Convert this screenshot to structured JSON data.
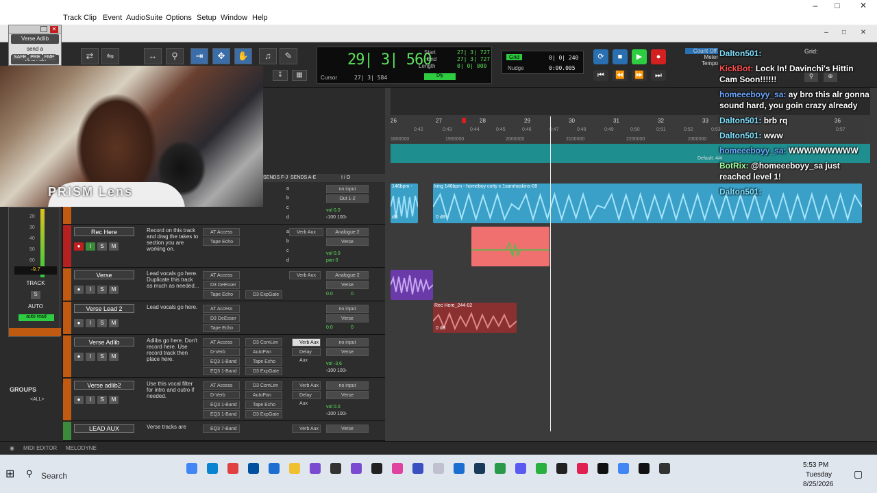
{
  "menu": {
    "items": [
      "Track",
      "Clip",
      "Event",
      "AudioSuite",
      "Options",
      "Setup",
      "Window",
      "Help"
    ]
  },
  "floatwin": {
    "title": "Verse Adlib",
    "send": "send a",
    "bus": "Verb Aux",
    "buttons": [
      "SAFE",
      "PRE",
      "FMP"
    ]
  },
  "counter": {
    "main": "29| 3| 560",
    "start_label": "Start",
    "end_label": "End",
    "length_label": "Length",
    "start": "27| 3| 727",
    "end": "27| 3| 727",
    "length": "0| 0| 000",
    "cursor_label": "Cursor",
    "cursor": "27| 3| 584"
  },
  "grid": {
    "grid_label": "Grid",
    "grid_value": "0| 0| 240",
    "nudge_label": "Nudge",
    "nudge_value": "0:00.005",
    "grid_label_right": "Grid:"
  },
  "transport": {
    "count_off": "Count Off",
    "meter": "Meter",
    "tempo": "Tempo"
  },
  "webcam": {
    "label": "PRISM Lens"
  },
  "left": {
    "level": "-9.7",
    "track_label": "TRACK",
    "s_label": "S",
    "auto_label": "AUTO",
    "auto_read": "auto read",
    "groups": "GROUPS",
    "all": "<ALL>"
  },
  "columns": {
    "sends": "SENDS F-J",
    "sends_ae": "SENDS A-E",
    "io": "I / O"
  },
  "tracks": [
    {
      "name": "",
      "comment": "",
      "inserts": [],
      "sends": [],
      "io": [
        "no input",
        "Out 1-2"
      ],
      "vol": "vol 0.0",
      "pan": "‹100 100›"
    },
    {
      "name": "Rec Here",
      "comment": "Record on this track and drag the takes to section you are working on.",
      "inserts": [
        "AT Access",
        "Tape Echo"
      ],
      "sends": [
        "Verb Aux"
      ],
      "io": [
        "Analogue 2",
        "Verse"
      ],
      "vol": "vol 0.0",
      "pan": "pan 0"
    },
    {
      "name": "Verse",
      "comment": "Lead vocals go here. Duplicate this track as much as needed...",
      "inserts": [
        "AT Access",
        "D3 DeEsser",
        "Tape Echo"
      ],
      "sends2": [
        "D3 ExpGate"
      ],
      "sends": [
        "Verb Aux"
      ],
      "io": [
        "Analogue 2",
        "Verse"
      ],
      "vol": "0.0",
      "pan": "0"
    },
    {
      "name": "Verse Lead 2",
      "comment": "Lead vocals go here.",
      "inserts": [
        "AT Access",
        "D3 DeEsser",
        "Tape Echo"
      ],
      "sends": [],
      "io": [
        "no input",
        "Verse"
      ],
      "vol": "0.0",
      "pan": "0"
    },
    {
      "name": "Verse Adlib",
      "comment": "Adlibs go here. Don't record here. Use record track then place here.",
      "inserts": [
        "AT Access",
        "D-Verb",
        "EQ3 1-Band",
        "EQ3 1-Band"
      ],
      "sends2": [
        "D3 ComLim",
        "AutoPan",
        "Tape Echo",
        "D3 ExpGate"
      ],
      "sends": [
        "Verb Aux",
        "Delay Aux"
      ],
      "io": [
        "no input",
        "Verse"
      ],
      "vol": "vol -3.6",
      "pan": "‹100 100›"
    },
    {
      "name": "Verse adlib2",
      "comment": "Use this vocal filter for intro and outro if needed.",
      "inserts": [
        "AT Access",
        "D-Verb",
        "EQ3 1-Band",
        "EQ3 1-Band"
      ],
      "sends2": [
        "D3 ComLim",
        "AutoPan",
        "Tape Echo",
        "D3 ExpGate"
      ],
      "sends": [
        "Verb Aux",
        "Delay Aux"
      ],
      "io": [
        "no input",
        "Verse"
      ],
      "vol": "vol 0.0",
      "pan": "‹100 100›"
    },
    {
      "name": "LEAD AUX",
      "comment": "Verse tracks are",
      "inserts": [
        "EQ3 7-Band"
      ],
      "sends": [
        "Verb Aux"
      ],
      "io": [
        "Verse"
      ],
      "vol": "",
      "pan": ""
    }
  ],
  "ruler": {
    "bars": [
      "26",
      "27",
      "28",
      "29",
      "30",
      "31",
      "32",
      "33",
      "36"
    ],
    "ticks": [
      "0:42",
      "0:43",
      "0:44",
      "0:45",
      "0:46",
      "0:47",
      "0:48",
      "0:49",
      "0:50",
      "0:51",
      "0:52",
      "0:53",
      "0:57"
    ],
    "samples": [
      "1800000",
      "1900000",
      "2000000",
      "2100000",
      "2200000",
      "2300000"
    ],
    "meter": "Default: 4/4"
  },
  "clips": {
    "main_title": "king 146bpm - homeboy cotty x 1samhaskins-08",
    "left_title": "146bpm -",
    "gain": "0 dB",
    "dB": "dB",
    "rec_title": "Rec Here_244-02",
    "rec_gain": "0 dB"
  },
  "chat": [
    {
      "user": "Dalton501:",
      "msg": "",
      "cls": "u1"
    },
    {
      "user": "KickBot:",
      "msg": "Lock In! Davinchi's Hittin Cam Soon!!!!!!",
      "cls": "u3"
    },
    {
      "user": "homeeeboyy_sa:",
      "msg": "ay bro this alr gonna sound hard, you goin crazy already",
      "cls": "u2"
    },
    {
      "user": "Dalton501:",
      "msg": "brb rq",
      "cls": "u1"
    },
    {
      "user": "Dalton501:",
      "msg": "www",
      "cls": "u1"
    },
    {
      "user": "homeeeboyy_sa:",
      "msg": "WWWWWWWWW",
      "cls": "u2"
    },
    {
      "user": "BotRix:",
      "msg": "@homeeeboyy_sa just reached level 1!",
      "cls": "u4"
    },
    {
      "user": "Dalton501:",
      "msg": "",
      "cls": "u1"
    }
  ],
  "bottom": {
    "midi": "MIDI EDITOR",
    "melodyne": "MELODYNE"
  },
  "taskbar": {
    "search": "Search",
    "time": "5:53 PM",
    "day": "Tuesday",
    "date": "8/25/2026"
  },
  "colors": {
    "playing": "#2ecc40",
    "record": "#d32020",
    "tempo_lane": "#1f8e8e",
    "main_clip": "#3aa0c8",
    "rec_clip_pink": "#f07070",
    "verse_clip": "#6a3aa8",
    "lead2_clip": "#8a3030"
  }
}
